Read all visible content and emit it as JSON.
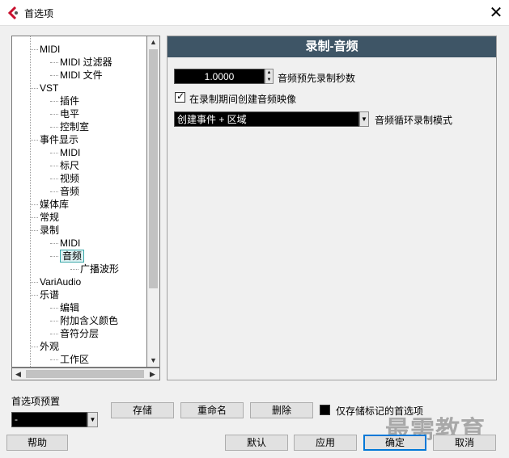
{
  "window": {
    "title": "首选项"
  },
  "tree": {
    "items": [
      {
        "label": "MIDI",
        "level": 1
      },
      {
        "label": "MIDI 过滤器",
        "level": 2
      },
      {
        "label": "MIDI 文件",
        "level": 2
      },
      {
        "label": "VST",
        "level": 1
      },
      {
        "label": "插件",
        "level": 2
      },
      {
        "label": "电平",
        "level": 2
      },
      {
        "label": "控制室",
        "level": 2
      },
      {
        "label": "事件显示",
        "level": 1
      },
      {
        "label": "MIDI",
        "level": 2
      },
      {
        "label": "标尺",
        "level": 2
      },
      {
        "label": "视频",
        "level": 2
      },
      {
        "label": "音频",
        "level": 2
      },
      {
        "label": "媒体库",
        "level": 1
      },
      {
        "label": "常规",
        "level": 1
      },
      {
        "label": "录制",
        "level": 1
      },
      {
        "label": "MIDI",
        "level": 2
      },
      {
        "label": "音频",
        "level": 2,
        "selected": true
      },
      {
        "label": "广播波形",
        "level": 3
      },
      {
        "label": "VariAudio",
        "level": 1
      },
      {
        "label": "乐谱",
        "level": 1
      },
      {
        "label": "编辑",
        "level": 2
      },
      {
        "label": "附加含义颜色",
        "level": 2
      },
      {
        "label": "音符分层",
        "level": 2
      },
      {
        "label": "外观",
        "level": 1
      },
      {
        "label": "工作区",
        "level": 2
      }
    ]
  },
  "panel": {
    "title": "录制-音频",
    "preroll_value": "1.0000",
    "preroll_label": "音频预先录制秒数",
    "create_images_label": "在录制期间创建音频映像",
    "create_images_checked": true,
    "cycle_mode_value": "创建事件 + 区域",
    "cycle_mode_label": "音频循环录制模式"
  },
  "presets": {
    "label": "首选项预置",
    "selected": "-",
    "store_label": "存储",
    "rename_label": "重命名",
    "delete_label": "删除",
    "marked_only_label": "仅存储标记的首选项"
  },
  "footer": {
    "help_label": "帮助",
    "defaults_label": "默认",
    "apply_label": "应用",
    "ok_label": "确定",
    "cancel_label": "取消"
  },
  "watermark": "最需教育",
  "colors": {
    "header_bg": "#3e5566",
    "accent": "#0078d7",
    "app_icon": "#c8102e"
  }
}
